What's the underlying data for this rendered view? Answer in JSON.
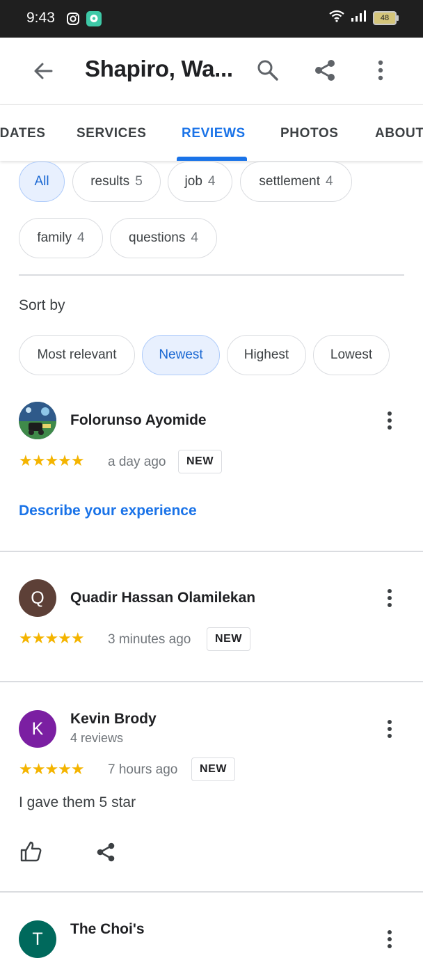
{
  "status_bar": {
    "time": "9:43",
    "battery": "48"
  },
  "app_bar": {
    "title": "Shapiro, Wa..."
  },
  "tabs": [
    {
      "label": "UPDATES"
    },
    {
      "label": "SERVICES"
    },
    {
      "label": "REVIEWS"
    },
    {
      "label": "PHOTOS"
    },
    {
      "label": "ABOUT"
    }
  ],
  "topic_chips": [
    {
      "label": "All",
      "count": ""
    },
    {
      "label": "results",
      "count": "5"
    },
    {
      "label": "job",
      "count": "4"
    },
    {
      "label": "settlement",
      "count": "4"
    },
    {
      "label": "family",
      "count": "4"
    },
    {
      "label": "questions",
      "count": "4"
    }
  ],
  "sort": {
    "label": "Sort by",
    "options": [
      "Most relevant",
      "Newest",
      "Highest",
      "Lowest"
    ],
    "selected": "Newest"
  },
  "reviews": [
    {
      "name": "Folorunso Ayomide",
      "stars": "★★★★★",
      "rating": 5,
      "time": "a day ago",
      "badge": "NEW",
      "action": "Describe your experience"
    },
    {
      "name": "Quadir Hassan Olamilekan",
      "initial": "Q",
      "stars": "★★★★★",
      "rating": 5,
      "time": "3 minutes ago",
      "badge": "NEW"
    },
    {
      "name": "Kevin Brody",
      "initial": "K",
      "subtitle": "4 reviews",
      "stars": "★★★★★",
      "rating": 5,
      "time": "7 hours ago",
      "badge": "NEW",
      "text": "I gave them 5 star"
    },
    {
      "name": "The Choi's",
      "initial": "T"
    }
  ],
  "colors": {
    "accent": "#1a73e8",
    "star": "#f4b400",
    "avatar_q": "#5d4037",
    "avatar_k": "#7b1fa2",
    "avatar_t": "#00695c"
  },
  "icons": [
    "back-arrow-icon",
    "search-icon",
    "share-icon",
    "more-vert-icon",
    "thumb-up-icon"
  ]
}
